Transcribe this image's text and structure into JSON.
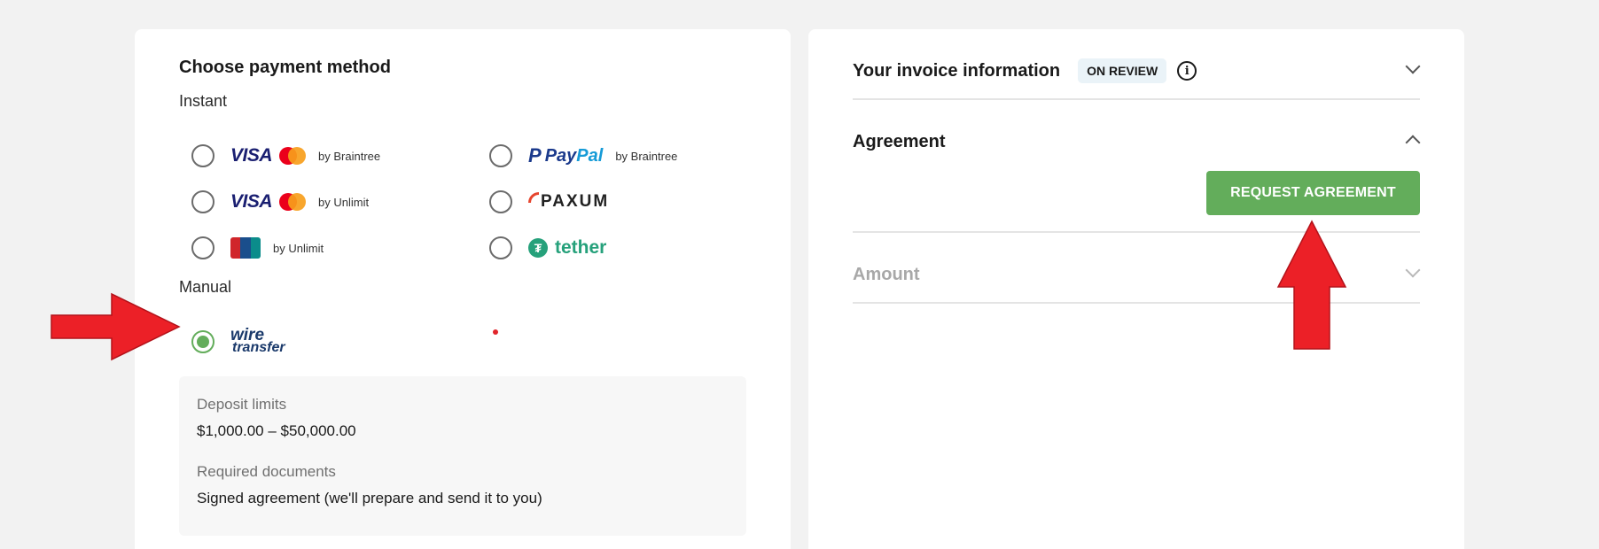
{
  "payment": {
    "title": "Choose payment method",
    "instant_label": "Instant",
    "manual_label": "Manual",
    "options": {
      "visa_braintree": {
        "brand": "VISA",
        "provider": "by Braintree",
        "selected": false
      },
      "paypal_braintree": {
        "brand_pay": "Pay",
        "brand_pal": "Pal",
        "provider": "by Braintree",
        "selected": false
      },
      "visa_unlimit": {
        "brand": "VISA",
        "provider": "by Unlimit",
        "selected": false
      },
      "paxum": {
        "brand": "PAXUM",
        "selected": false
      },
      "unionpay_unlimit": {
        "provider": "by Unlimit",
        "selected": false
      },
      "tether": {
        "brand": "tether",
        "icon_glyph": "₮",
        "selected": false
      },
      "wire_transfer": {
        "brand_line1": "wire",
        "brand_line2": "transfer",
        "selected": true
      }
    },
    "info": {
      "deposit_limits_label": "Deposit limits",
      "deposit_limits_value": "$1,000.00 – $50,000.00",
      "required_docs_label": "Required documents",
      "required_docs_value": "Signed agreement (we'll prepare and send it to you)"
    }
  },
  "invoice": {
    "title": "Your invoice information",
    "status_badge": "ON REVIEW",
    "info_glyph": "i"
  },
  "agreement": {
    "title": "Agreement",
    "button_label": "REQUEST AGREEMENT"
  },
  "amount": {
    "title": "Amount"
  },
  "colors": {
    "accent_green": "#63ad5b",
    "annotation_red": "#e1252b",
    "badge_bg": "#eaf3f8"
  }
}
